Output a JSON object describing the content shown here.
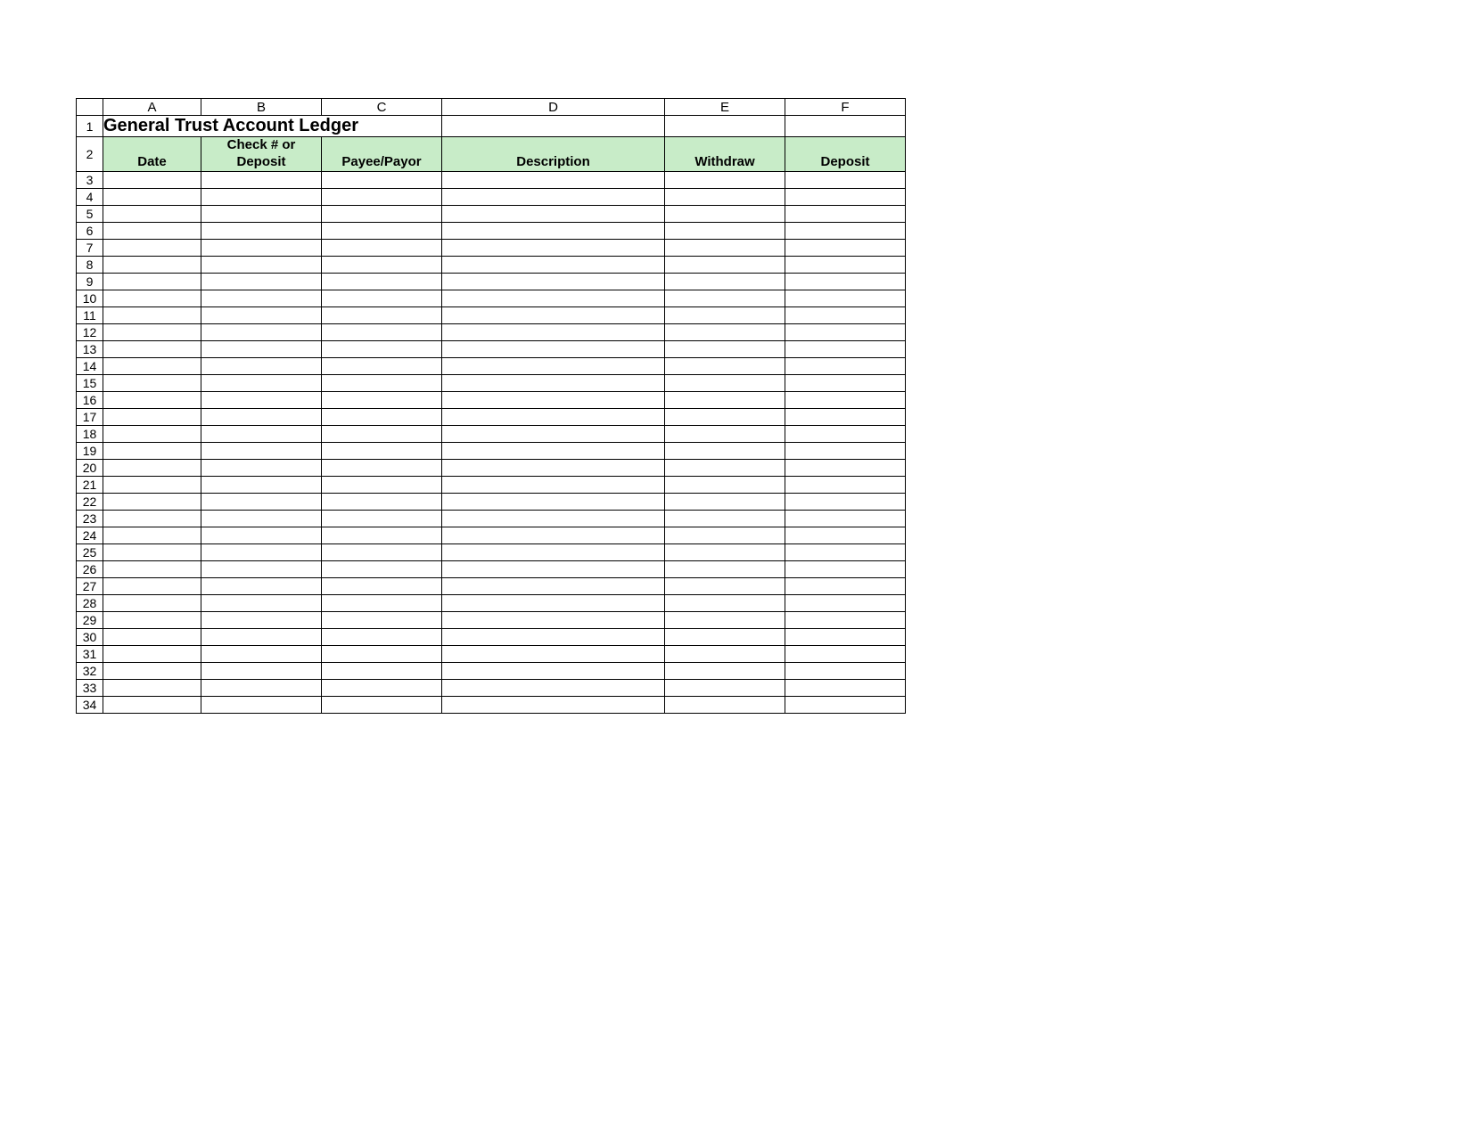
{
  "columns": [
    "A",
    "B",
    "C",
    "D",
    "E",
    "F"
  ],
  "title": "General Trust Account Ledger",
  "headers": {
    "A": {
      "line1": "",
      "line2": "Date"
    },
    "B": {
      "line1": "Check # or",
      "line2": "Deposit"
    },
    "C": {
      "line1": "",
      "line2": "Payee/Payor"
    },
    "D": {
      "line1": "",
      "line2": "Description"
    },
    "E": {
      "line1": "",
      "line2": "Withdraw"
    },
    "F": {
      "line1": "",
      "line2": "Deposit"
    }
  },
  "row_numbers": [
    1,
    2,
    3,
    4,
    5,
    6,
    7,
    8,
    9,
    10,
    11,
    12,
    13,
    14,
    15,
    16,
    17,
    18,
    19,
    20,
    21,
    22,
    23,
    24,
    25,
    26,
    27,
    28,
    29,
    30,
    31,
    32,
    33,
    34
  ],
  "data_rows_start": 3,
  "data_rows_end": 34
}
